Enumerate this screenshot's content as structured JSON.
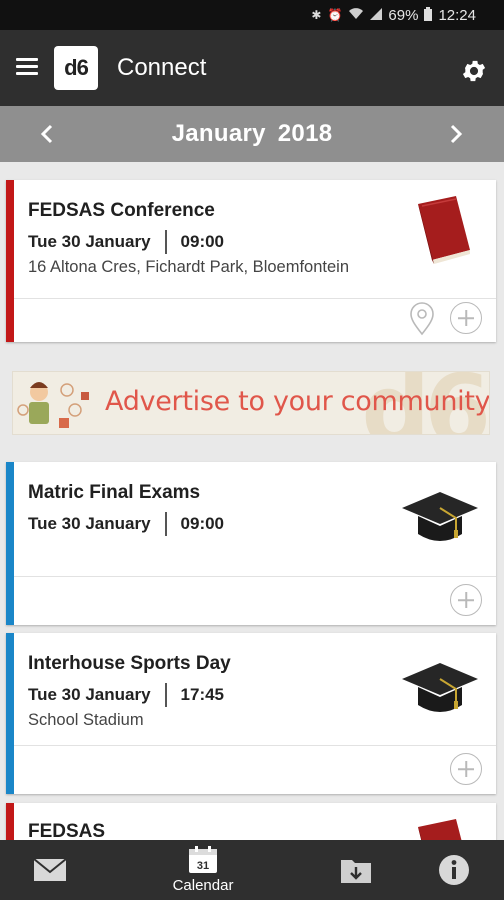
{
  "status_bar": {
    "battery": "69%",
    "time": "12:24",
    "icons": [
      "bluetooth-icon",
      "alarm-icon",
      "wifi-icon",
      "signal-icon",
      "battery-icon"
    ]
  },
  "app_bar": {
    "logo_text": "d6",
    "title": "Connect",
    "menu_icon": "hamburger-menu-icon",
    "settings_icon": "gear-icon"
  },
  "month_bar": {
    "month": "January",
    "year": "2018",
    "prev_icon": "chevron-left-icon",
    "next_icon": "chevron-right-icon"
  },
  "events": [
    {
      "title": "FEDSAS Conference",
      "date": "Tue 30 January",
      "time": "09:00",
      "location": "16 Altona Cres, Fichardt Park, Bloemfontein",
      "accent_color": "#c21818",
      "icon": "book-icon",
      "actions": [
        "map-pin-icon",
        "add-icon"
      ]
    },
    {
      "title": "Matric Final Exams",
      "date": "Tue 30 January",
      "time": "09:00",
      "location": "",
      "accent_color": "#1a86c8",
      "icon": "graduation-cap-icon",
      "actions": [
        "add-icon"
      ]
    },
    {
      "title": "Interhouse Sports Day",
      "date": "Tue 30 January",
      "time": "17:45",
      "location": "School Stadium",
      "accent_color": "#1a86c8",
      "icon": "graduation-cap-icon",
      "actions": [
        "add-icon"
      ]
    },
    {
      "title": "FEDSAS",
      "accent_color": "#c21818",
      "icon": "book-icon"
    }
  ],
  "ad_banner": {
    "text": "Advertise to your community.",
    "watermark": "d6"
  },
  "bottom_nav": [
    {
      "id": "messages",
      "icon": "envelope-icon",
      "label": ""
    },
    {
      "id": "calendar",
      "icon": "calendar-icon",
      "label": "Calendar",
      "icon_text": "31",
      "selected": true
    },
    {
      "id": "downloads",
      "icon": "download-folder-icon",
      "label": ""
    },
    {
      "id": "info",
      "icon": "info-icon",
      "label": ""
    }
  ]
}
